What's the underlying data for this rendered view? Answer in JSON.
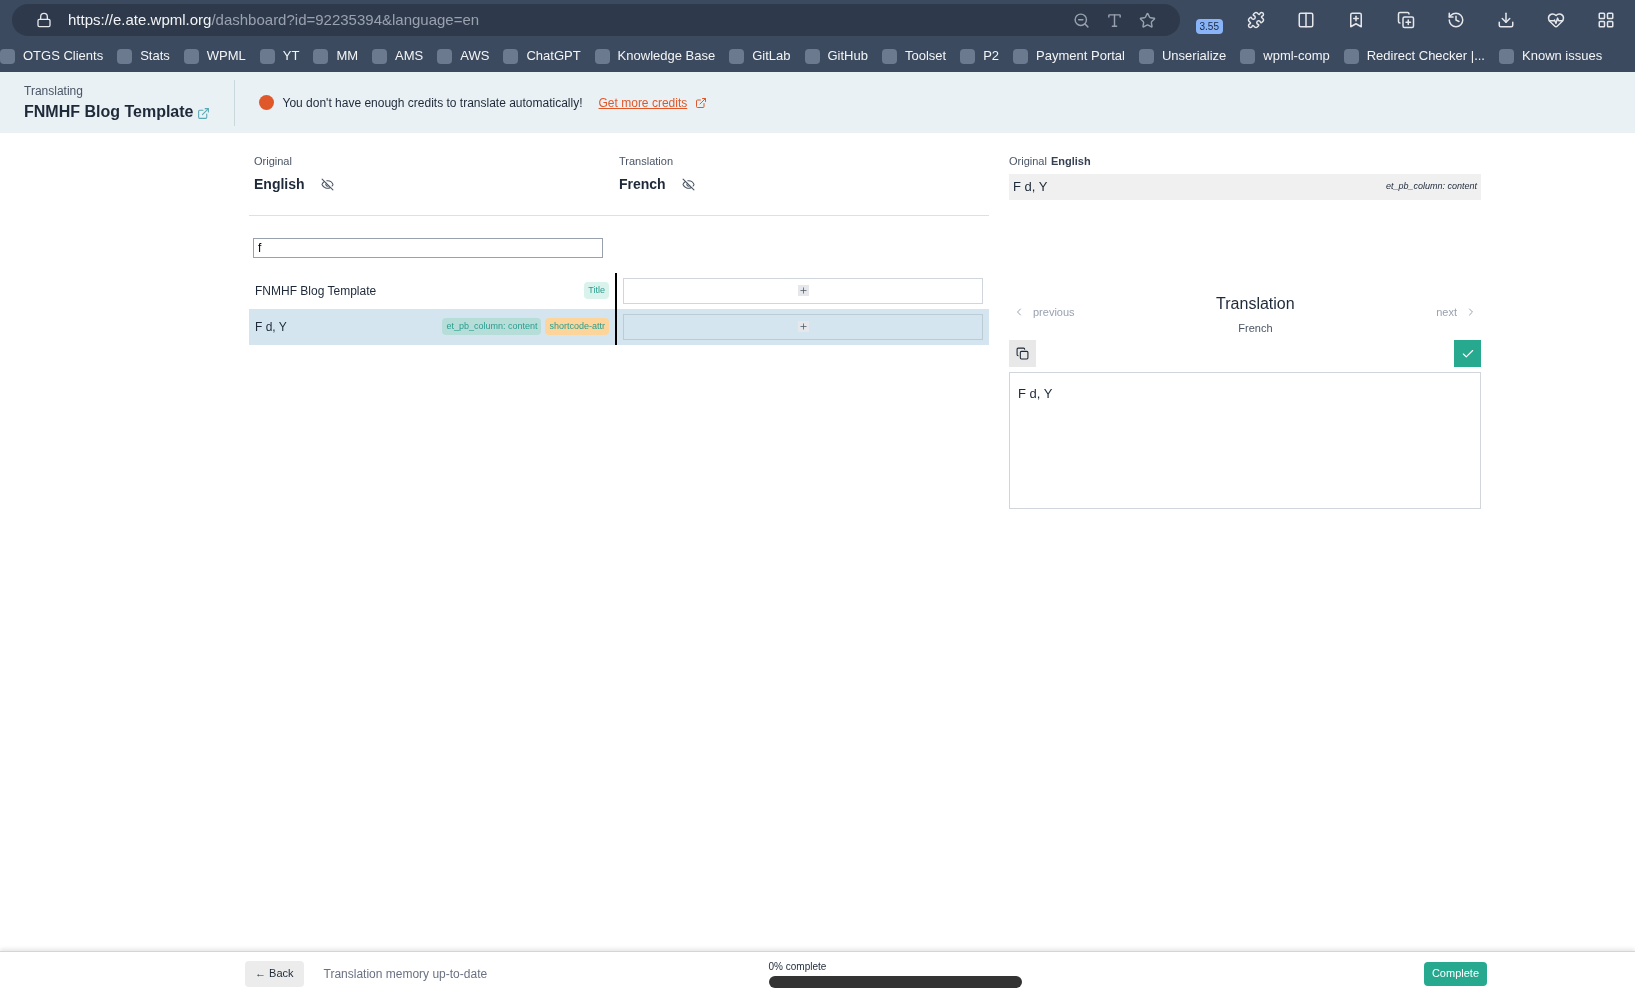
{
  "browser": {
    "url_host": "https://e.ate.wpml.org",
    "url_path": "/dashboard?id=92235394&language=en",
    "extension_badge": "3.55",
    "bookmarks": [
      "OTGS Clients",
      "Stats",
      "WPML",
      "YT",
      "MM",
      "AMS",
      "AWS",
      "ChatGPT",
      "Knowledge Base",
      "GitLab",
      "GitHub",
      "Toolset",
      "P2",
      "Payment Portal",
      "Unserialize",
      "wpml-comp",
      "Redirect Checker |...",
      "Known issues"
    ]
  },
  "header": {
    "label": "Translating",
    "title": "FNMHF Blog Template",
    "alert": "You don't have enough credits to translate automatically!",
    "alert_link": "Get more credits"
  },
  "columns": [
    {
      "label": "Original",
      "language": "English"
    },
    {
      "label": "Translation",
      "language": "French"
    }
  ],
  "search": {
    "value": "f"
  },
  "rows": [
    {
      "text": "FNMHF Blog Template",
      "selected": false,
      "tags": [
        {
          "text": "Title",
          "color": "#d9f2ec"
        }
      ]
    },
    {
      "text": "F d, Y",
      "selected": true,
      "tags": [
        {
          "text": "et_pb_column: content",
          "color": "#b7ddd9"
        },
        {
          "text": "shortcode-attr",
          "color": "#fdd59a"
        }
      ]
    }
  ],
  "detail": {
    "original_label": "Original",
    "original_language": "English",
    "original_text": "F d, Y",
    "original_tag": "et_pb_column: content",
    "previous": "previous",
    "next": "next",
    "translation_title": "Translation",
    "translation_language": "French",
    "translation_text": "F d, Y"
  },
  "footer": {
    "back": "← Back",
    "memory": "Translation memory up-to-date",
    "progress_label": "0% complete",
    "level": 0,
    "complete": "Complete"
  }
}
